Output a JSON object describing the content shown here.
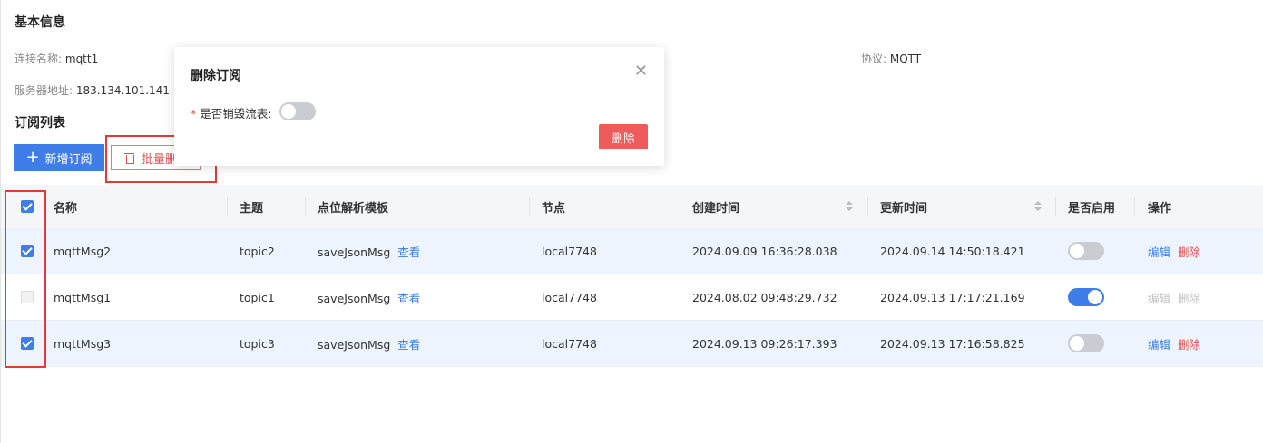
{
  "basic_info": {
    "title": "基本信息",
    "conn_name_label": "连接名称:",
    "conn_name_value": "mqtt1",
    "server_label": "服务器地址:",
    "server_value": "183.134.101.141",
    "protocol_label": "协议:",
    "protocol_value": "MQTT"
  },
  "sub_list": {
    "title": "订阅列表",
    "add_label": "新增订阅",
    "batch_delete_label": "批量删"
  },
  "table": {
    "headers": [
      "名称",
      "主题",
      "点位解析模板",
      "节点",
      "创建时间",
      "更新时间",
      "是否启用",
      "操作"
    ],
    "view_label": "查看",
    "edit_label": "编辑",
    "delete_label": "删除",
    "rows": [
      {
        "checked": true,
        "name": "mqttMsg2",
        "topic": "topic2",
        "template": "saveJsonMsg",
        "node": "local7748",
        "created": "2024.09.09 16:36:28.038",
        "updated": "2024.09.14 14:50:18.421",
        "enabled": false
      },
      {
        "checked": false,
        "name": "mqttMsg1",
        "topic": "topic1",
        "template": "saveJsonMsg",
        "node": "local7748",
        "created": "2024.08.02 09:48:29.732",
        "updated": "2024.09.13 17:17:21.169",
        "enabled": true
      },
      {
        "checked": true,
        "name": "mqttMsg3",
        "topic": "topic3",
        "template": "saveJsonMsg",
        "node": "local7748",
        "created": "2024.09.13 09:26:17.393",
        "updated": "2024.09.13 17:16:58.825",
        "enabled": false
      }
    ]
  },
  "modal": {
    "title": "删除订阅",
    "close_glyph": "✕",
    "field_label": "是否销毁流表:",
    "field_value": false,
    "confirm_label": "删除"
  },
  "colors": {
    "primary": "#3f7ee8",
    "danger": "#e25050",
    "annotation": "#e53935"
  }
}
